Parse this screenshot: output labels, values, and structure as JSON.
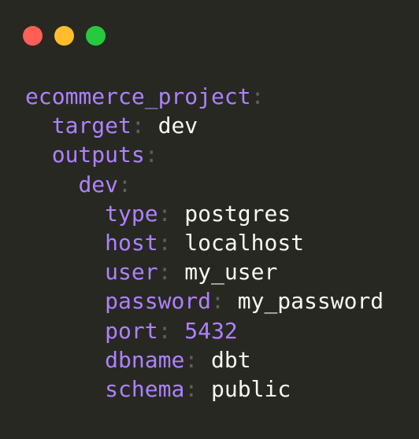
{
  "colors": {
    "background": "#272822",
    "close": "#ff5f56",
    "minimize": "#ffbd2e",
    "maximize": "#27c93f",
    "key": "#ae81ff",
    "text": "#f8f8f2",
    "punctuation": "#5f5f55"
  },
  "window_controls": {
    "close_icon": "red-circle",
    "minimize_icon": "yellow-circle",
    "maximize_icon": "green-circle"
  },
  "code": {
    "lines": [
      {
        "indent": "",
        "key": "ecommerce_project",
        "colon": ":",
        "value": ""
      },
      {
        "indent": "  ",
        "key": "target",
        "colon": ":",
        "value": " dev"
      },
      {
        "indent": "  ",
        "key": "outputs",
        "colon": ":",
        "value": ""
      },
      {
        "indent": "    ",
        "key": "dev",
        "colon": ":",
        "value": ""
      },
      {
        "indent": "      ",
        "key": "type",
        "colon": ":",
        "value": " postgres"
      },
      {
        "indent": "      ",
        "key": "host",
        "colon": ":",
        "value": " localhost"
      },
      {
        "indent": "      ",
        "key": "user",
        "colon": ":",
        "value": " my_user"
      },
      {
        "indent": "      ",
        "key": "password",
        "colon": ":",
        "value": " my_password"
      },
      {
        "indent": "      ",
        "key": "port",
        "colon": ":",
        "value": " 5432"
      },
      {
        "indent": "      ",
        "key": "dbname",
        "colon": ":",
        "value": " dbt"
      },
      {
        "indent": "      ",
        "key": "schema",
        "colon": ":",
        "value": " public"
      }
    ]
  }
}
